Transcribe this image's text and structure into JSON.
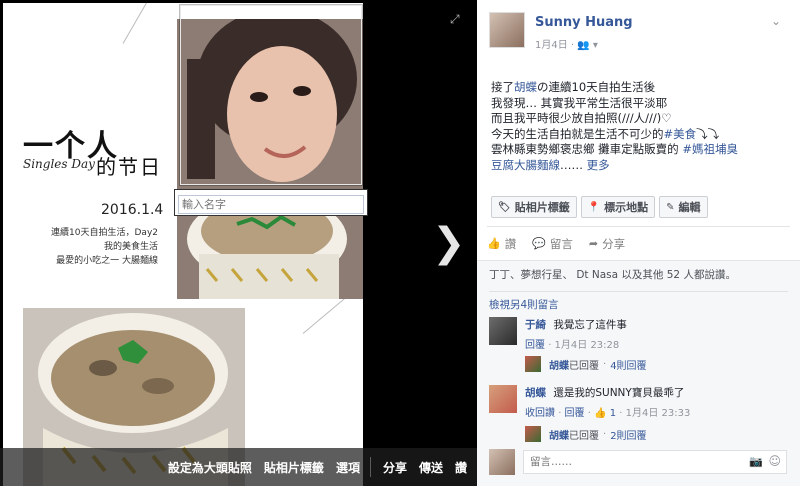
{
  "photo": {
    "title_main": "一个人",
    "title_sub_en": "Singles Day",
    "title_sub_zh": "的节日",
    "date": "2016.1.4",
    "lines": [
      "連續10天自拍生活，Day2",
      "我的美食生活",
      "最愛的小吃之一 大腸麵線"
    ],
    "tag_placeholder": "輸入名字"
  },
  "toolbar": {
    "set_profile": "設定為大頭貼照",
    "tag_photo": "貼相片標籤",
    "options": "選項",
    "share": "分享",
    "send": "傳送",
    "like": "讚"
  },
  "post": {
    "author": "Sunny Huang",
    "date": "1月4日",
    "text_lines": [
      [
        {
          "t": "接了"
        },
        {
          "t": "胡蝶",
          "link": true
        },
        {
          "t": "の連續10天自拍生活後"
        }
      ],
      [
        {
          "t": "我發現… 其實我平常生活很平淡耶"
        }
      ],
      [
        {
          "t": "而且我平時很少放自拍照(///人///)♡"
        }
      ],
      [
        {
          "t": "今天的生活自拍就是生活不可少的"
        },
        {
          "t": "#美食",
          "link": true
        },
        {
          "t": "⤵⤵"
        }
      ],
      [
        {
          "t": "雲林縣東勢鄉褒忠鄉 攤車定點販賣的 "
        },
        {
          "t": "#媽祖埔臭",
          "link": true
        }
      ],
      [
        {
          "t": "豆腐大腸麵線",
          "link": true
        },
        {
          "t": "…… "
        },
        {
          "t": "更多",
          "link": true
        }
      ]
    ],
    "buttons": [
      "貼相片標籤",
      "標示地點",
      "編輯"
    ],
    "actions": [
      "讚",
      "留言",
      "分享"
    ],
    "likes_text": "丁丁、夢想行星、 Dt Nasa 以及其他 52 人都說讚。",
    "view_more": "檢視另4則留言",
    "comments": [
      {
        "author": "于綺",
        "text": "我覺忘了這件事",
        "reply_link": "回覆",
        "time": "1月4日 23:28",
        "like_count": "",
        "reply_summary": {
          "name": "胡蝶",
          "label": "已回覆",
          "dot": "·",
          "count": "4則回覆"
        }
      },
      {
        "author": "胡蝶",
        "text": "還是我的SUNNY寶貝最乖了",
        "reply_link": "收回讚",
        "reply2": "回覆",
        "like_count": "1",
        "time": "1月4日 23:33",
        "reply_summary": {
          "name": "胡蝶",
          "label": "已回覆",
          "dot": "·",
          "count": "2則回覆"
        }
      }
    ],
    "compose_placeholder": "留言……"
  }
}
